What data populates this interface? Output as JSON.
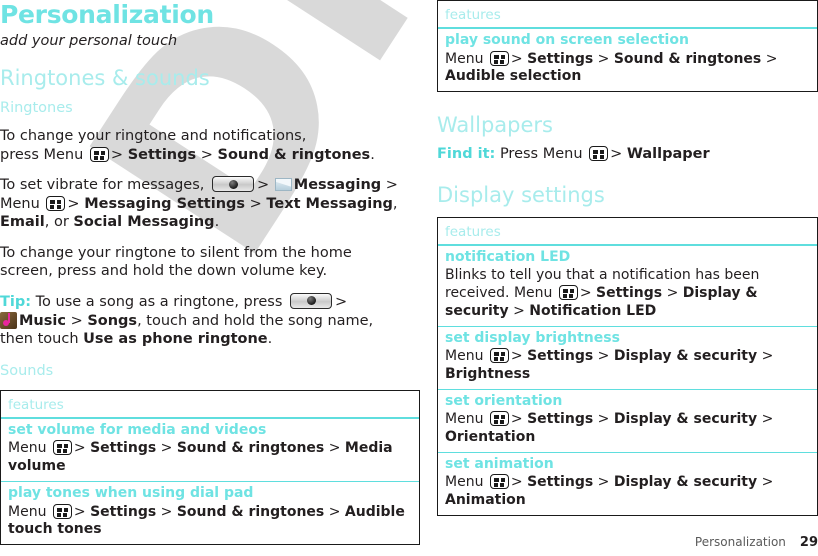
{
  "chapter": {
    "title": "Personalization",
    "subtitle": "add your personal touch"
  },
  "watermark": {
    "text": "DRAFT"
  },
  "icons": {
    "menu": "menu-key-icon",
    "launcher": "launcher-key-icon",
    "messaging": "messaging-app-icon",
    "music": "music-app-icon"
  },
  "left_column": {
    "section_ringtones_sounds": "Ringtones & sounds",
    "subsection_ringtones": "Ringtones",
    "para1": {
      "line1": "To change your ringtone and notifications,",
      "line2_pre": "press Menu",
      "seg_gt1": ">",
      "bold_settings": "Settings",
      "seg_gt2": ">",
      "bold_sound_ringtones": "Sound & ringtones",
      "period": "."
    },
    "para2": {
      "pre": "To set vibrate for messages,",
      "gt1": ">",
      "bold_messaging": "Messaging",
      "gt2": ">",
      "menu_word": "Menu",
      "gt3": ">",
      "bold_messaging_settings": "Messaging Settings",
      "gt4": ">",
      "bold_text_messaging": "Text Messaging",
      "comma": ",",
      "bold_email": "Email",
      "or_word": ", or ",
      "bold_social_messaging": "Social Messaging",
      "period": "."
    },
    "para3": {
      "line1": "To change your ringtone to silent from the home",
      "line2": "screen, press and hold the down volume key."
    },
    "tip": {
      "label": "Tip:",
      "pre": "To use a song as a ringtone, press",
      "gt1": ">",
      "bold_music": "Music",
      "gt2": ">",
      "bold_songs": "Songs",
      "mid": ", touch and hold the song name,",
      "then": "then touch",
      "bold_use_as": "Use as phone ringtone",
      "period": "."
    },
    "subsection_sounds": "Sounds",
    "table": {
      "header": "features",
      "rows": [
        {
          "name": "set volume for media and videos",
          "desc_pre": "Menu",
          "desc_gt1": ">",
          "desc_b1": "Settings",
          "desc_gt2": ">",
          "desc_b2": "Sound & ringtones",
          "desc_gt3": ">",
          "desc_b3": "Media volume"
        },
        {
          "name": "play tones when using dial pad",
          "desc_pre": "Menu",
          "desc_gt1": ">",
          "desc_b1": "Settings",
          "desc_gt2": ">",
          "desc_b2": "Sound & ringtones",
          "desc_gt3": ">",
          "desc_b3": "Audible touch tones"
        }
      ]
    }
  },
  "right_column": {
    "table_sounds_cont": {
      "header": "features",
      "rows": [
        {
          "name": "play sound on screen selection",
          "desc_pre": "Menu",
          "desc_gt1": ">",
          "desc_b1": "Settings",
          "desc_gt2": ">",
          "desc_b2": "Sound & ringtones",
          "desc_gt3": ">",
          "desc_b3": "Audible selection"
        }
      ]
    },
    "section_wallpapers": "Wallpapers",
    "findit": {
      "label": "Find it:",
      "pre": "Press Menu",
      "gt1": ">",
      "bold_wallpaper": "Wallpaper"
    },
    "section_display_settings": "Display settings",
    "table_display": {
      "header": "features",
      "rows": [
        {
          "name": "notification LED",
          "desc_lead": "Blinks to tell you that a notification has been received. Menu",
          "desc_gt1": ">",
          "desc_b1": "Settings",
          "desc_gt2": ">",
          "desc_b2": "Display & security",
          "desc_gt3": ">",
          "desc_b3": "Notification LED"
        },
        {
          "name": "set display brightness",
          "desc_pre": "Menu",
          "desc_gt1": ">",
          "desc_b1": "Settings",
          "desc_gt2": ">",
          "desc_b2": "Display & security",
          "desc_gt3": ">",
          "desc_b3": "Brightness"
        },
        {
          "name": "set orientation",
          "desc_pre": "Menu",
          "desc_gt1": ">",
          "desc_b1": "Settings",
          "desc_gt2": ">",
          "desc_b2": "Display & security",
          "desc_gt3": ">",
          "desc_b3": "Orientation"
        },
        {
          "name": "set animation",
          "desc_pre": "Menu",
          "desc_gt1": ">",
          "desc_b1": "Settings",
          "desc_gt2": ">",
          "desc_b2": "Display & security",
          "desc_gt3": ">",
          "desc_b3": "Animation"
        }
      ]
    }
  },
  "footer": {
    "chapter_name": "Personalization",
    "page_number": "29"
  },
  "colors": {
    "heading_teal": "#6fe3e3",
    "light_teal": "#a8ecec",
    "rule_teal": "#5fdede",
    "text": "#231f20",
    "watermark_gray": "#d9d9d9"
  }
}
